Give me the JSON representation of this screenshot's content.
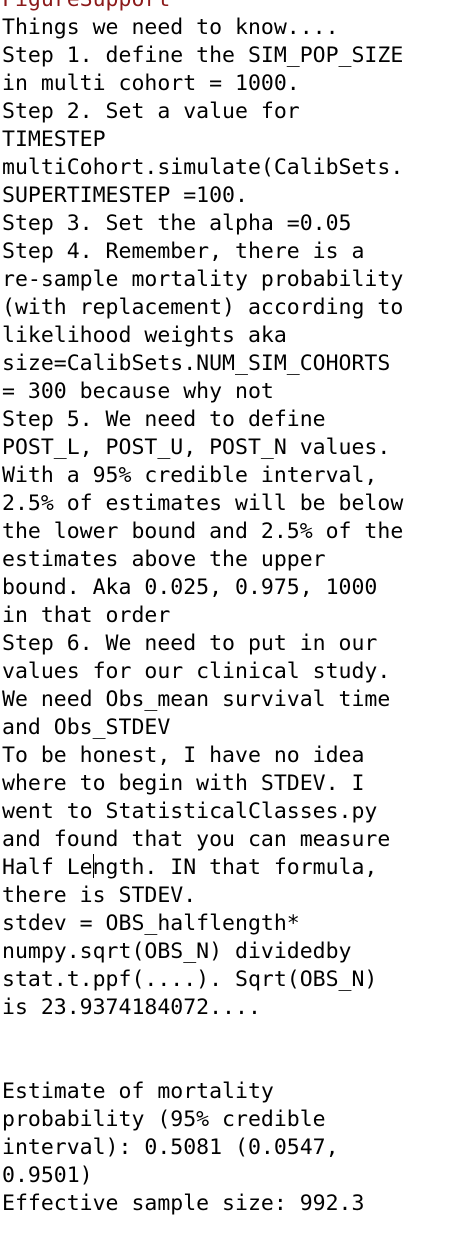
{
  "document": {
    "header": "FigureSupport",
    "lines": [
      "Things we need to know....",
      "Step 1. define the SIM_POP_SIZE",
      "in multi cohort = 1000.",
      "Step 2. Set a value for",
      "TIMESTEP",
      "multiCohort.simulate(CalibSets.",
      "SUPERTIMESTEP =100.",
      "Step 3. Set the alpha =0.05",
      "Step 4. Remember, there is a",
      "re-sample mortality probability",
      "(with replacement) according to",
      "likelihood weights aka",
      "size=CalibSets.NUM_SIM_COHORTS",
      "= 300 because why not",
      "Step 5. We need to define",
      "POST_L, POST_U, POST_N values.",
      "With a 95% credible interval,",
      "2.5% of estimates will be below",
      "the lower bound and 2.5% of the",
      "estimates above the upper",
      "bound. Aka 0.025, 0.975, 1000",
      "in that order",
      "Step 6. We need to put in our",
      "values for our clinical study.",
      "We need Obs_mean survival time",
      "and Obs_STDEV",
      "To be honest, I have no idea",
      "where to begin with STDEV. I",
      "went to StatisticalClasses.py",
      "and found that you can measure",
      "Half Length. IN that formula,",
      "there is STDEV.",
      "stdev = OBS_halflength*",
      "numpy.sqrt(OBS_N) dividedby",
      "stat.t.ppf(....). Sqrt(OBS_N)",
      "is 23.9374184072....",
      "",
      "",
      "Estimate of mortality",
      "probability (95% credible",
      "interval): 0.5081 (0.0547,",
      "0.9501)",
      "Effective sample size: 992.3"
    ],
    "caret_line_before": "Half Le",
    "caret_line_after": "ngth. IN that formula,"
  }
}
